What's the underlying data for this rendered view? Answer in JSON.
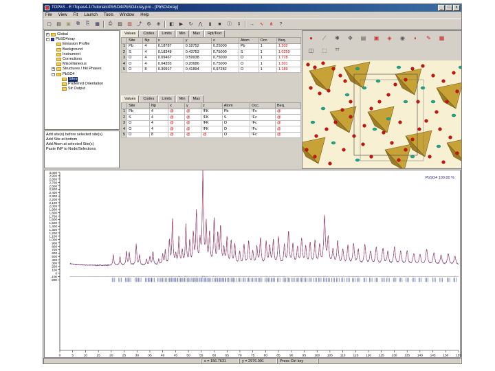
{
  "window": {
    "title": "TOPAS - E:\\Topas4-1\\Tutorials\\PbSO4\\PbSO4xray.pro - [PbSO4xray]",
    "minimize": "_",
    "maximize": "□",
    "close": "x"
  },
  "menu": [
    "File",
    "View",
    "Fit",
    "Launch",
    "Tools",
    "Window",
    "Help"
  ],
  "toolbar_icons": [
    "new-file-icon",
    "open-icon",
    "folder-icon",
    "copy-icon",
    "paste-icon",
    "save-icon",
    "print-icon",
    "fit-icon",
    "chart-icon",
    "launch-icon",
    "settings-icon",
    "zoom-icon",
    "diff-icon",
    "run-icon",
    "sync-icon",
    "peak-icon",
    "bar-icon",
    "stop-icon",
    "info-icon",
    "expand-icon",
    "arrow-icon",
    "wave-icon",
    "peaks-icon",
    "help-icon"
  ],
  "tree": [
    {
      "label": "Global",
      "depth": 0,
      "exp": "+",
      "icon": "folder",
      "sel": false
    },
    {
      "label": "PbSO4xray",
      "depth": 0,
      "exp": "−",
      "icon": "blue",
      "sel": false
    },
    {
      "label": "Emission Profile",
      "depth": 1,
      "exp": "",
      "icon": "folder",
      "sel": false
    },
    {
      "label": "Background",
      "depth": 1,
      "exp": "",
      "icon": "folder",
      "sel": false
    },
    {
      "label": "Instrument",
      "depth": 1,
      "exp": "",
      "icon": "folder",
      "sel": false
    },
    {
      "label": "Corrections",
      "depth": 1,
      "exp": "",
      "icon": "folder",
      "sel": false
    },
    {
      "label": "Miscellaneous",
      "depth": 1,
      "exp": "",
      "icon": "folder",
      "sel": false
    },
    {
      "label": "Structures / hkl Phases",
      "depth": 1,
      "exp": "+",
      "icon": "folder",
      "sel": false
    },
    {
      "label": "PbSO4",
      "depth": 1,
      "exp": "−",
      "icon": "folder",
      "sel": false
    },
    {
      "label": "Sites",
      "depth": 2,
      "exp": "",
      "icon": "folder",
      "sel": true
    },
    {
      "label": "Preferred Orientation",
      "depth": 2,
      "exp": "",
      "icon": "folder",
      "sel": false
    },
    {
      "label": "Str Output",
      "depth": 2,
      "exp": "",
      "icon": "folder",
      "sel": false
    }
  ],
  "context_menu": [
    "Add site(s) before selected site(s)",
    "Add Site at bottom",
    "Add Atom at selected Site(s)",
    "Paste INP to Node/Selections"
  ],
  "table1": {
    "tabs": [
      "Values",
      "Codes",
      "Limits",
      "Min",
      "Max",
      "Rpt/Text"
    ],
    "headers": [
      "",
      "Site",
      "Np",
      "x",
      "y",
      "z",
      "Atom",
      "Occ.",
      "Beq."
    ],
    "rows": [
      [
        "1",
        "Pb",
        "4",
        "0.18787",
        "0.18752",
        "0.25000",
        "Pb",
        "1",
        "1.302"
      ],
      [
        "2",
        "S",
        "4",
        "0.18348",
        "0.43753",
        "0.75000",
        "S",
        "1",
        "1.0259"
      ],
      [
        "3",
        "O",
        "4",
        "0.09467",
        "0.59938",
        "0.75000",
        "O",
        "1",
        "1.778"
      ],
      [
        "4",
        "O",
        "4",
        "0.04355",
        "0.20686",
        "0.75000",
        "O",
        "1",
        "1.301"
      ],
      [
        "5",
        "O",
        "8",
        "0.30917",
        "0.41894",
        "0.97282",
        "O",
        "1",
        "1.189"
      ]
    ]
  },
  "table2": {
    "tabs": [
      "Values",
      "Codes",
      "Limits",
      "Min",
      "Max"
    ],
    "headers": [
      "",
      "Site",
      "Np",
      "x",
      "y",
      "z",
      "Atom",
      "Occ.",
      "Beq."
    ],
    "rows": [
      [
        "1",
        "Pb",
        "4",
        "@",
        "@",
        "!FK",
        "Pb",
        "!Fc",
        "@"
      ],
      [
        "2",
        "S",
        "4",
        "@",
        "@",
        "!FK",
        "S",
        "!Fc",
        "@"
      ],
      [
        "3",
        "O",
        "4",
        "@",
        "@",
        "!FK",
        "O",
        "!Fc",
        "@"
      ],
      [
        "4",
        "O",
        "4",
        "@",
        "@",
        "!FK",
        "O",
        "!Fc",
        "@"
      ],
      [
        "5",
        "O",
        "8",
        "@",
        "@",
        "@",
        "O",
        "!Fc",
        "@"
      ]
    ]
  },
  "structure_icons": [
    "atom-icon",
    "bond-icon",
    "rotate-icon",
    "move-icon",
    "layers-icon",
    "box-icon",
    "view-icon",
    "sphere-icon",
    "color-icon",
    "pencil-icon",
    "grid-icon",
    "camera-icon",
    "select-icon",
    "tt-icon"
  ],
  "status": {
    "x": "x = 156.7631",
    "y": "y = 2976.091",
    "mode": "Press Ctrl key"
  },
  "colors": {
    "observed": "#22228a",
    "calc": "#cc4455",
    "diff": "#888888",
    "ticks": "#1f2a8a",
    "pb": "#c8120a",
    "s": "#1fa58a",
    "polyhedra": "#c7a237",
    "background": "#f7f0d2"
  },
  "chart_data": {
    "type": "line",
    "legend": "PbSO4 100.00 %",
    "xlim": [
      0,
      155
    ],
    "ylim": [
      -2300,
      3000
    ],
    "x_ticks": [
      0,
      5,
      10,
      15,
      20,
      25,
      30,
      35,
      40,
      45,
      50,
      55,
      60,
      65,
      70,
      75,
      80,
      85,
      90,
      95,
      100,
      105,
      110,
      115,
      120,
      125,
      130,
      135,
      140,
      145,
      150,
      155
    ],
    "y_ticks": [
      3000,
      2900,
      2800,
      2700,
      2600,
      2500,
      2400,
      2300,
      2200,
      2100,
      2000,
      1900,
      1800,
      1700,
      1600,
      1500,
      1400,
      1300,
      1200,
      1100,
      1000,
      900,
      800,
      700,
      600,
      500,
      400,
      300,
      200,
      100,
      0,
      -100,
      -200
    ],
    "y_tick_labels": [
      "3,000",
      "2,900",
      "2,800",
      "2,700",
      "2,600",
      "2,500",
      "2,400",
      "2,300",
      "2,200",
      "2,100",
      "2,000",
      "1,900",
      "1,800",
      "1,700",
      "1,600",
      "1,500",
      "1,400",
      "1,300",
      "1,200",
      "1,100",
      "1,000",
      "900",
      "800",
      "700",
      "600",
      "500",
      "400",
      "300",
      "200",
      "100",
      "0",
      "-100",
      "-200"
    ],
    "background_level": 230,
    "peaks": [
      [
        20.8,
        330
      ],
      [
        23.4,
        260
      ],
      [
        25.9,
        420
      ],
      [
        27.0,
        390
      ],
      [
        29.7,
        640
      ],
      [
        31.0,
        300
      ],
      [
        33.7,
        180
      ],
      [
        35.0,
        250
      ],
      [
        36.2,
        400
      ],
      [
        38.5,
        170
      ],
      [
        40.0,
        300
      ],
      [
        41.0,
        420
      ],
      [
        42.6,
        720
      ],
      [
        43.8,
        1350
      ],
      [
        45.1,
        300
      ],
      [
        46.3,
        830
      ],
      [
        47.6,
        400
      ],
      [
        49.0,
        1150
      ],
      [
        50.5,
        700
      ],
      [
        51.9,
        900
      ],
      [
        53.1,
        1560
      ],
      [
        54.5,
        650
      ],
      [
        55.6,
        2760
      ],
      [
        56.9,
        1200
      ],
      [
        58.2,
        900
      ],
      [
        60.0,
        1340
      ],
      [
        61.4,
        860
      ],
      [
        62.5,
        1100
      ],
      [
        63.8,
        450
      ],
      [
        65.0,
        800
      ],
      [
        66.6,
        700
      ],
      [
        68.0,
        600
      ],
      [
        69.9,
        380
      ],
      [
        71.6,
        600
      ],
      [
        73.4,
        700
      ],
      [
        75.0,
        400
      ],
      [
        76.6,
        520
      ],
      [
        78.0,
        780
      ],
      [
        80.2,
        660
      ],
      [
        81.6,
        540
      ],
      [
        83.0,
        700
      ],
      [
        85.0,
        820
      ],
      [
        87.3,
        560
      ],
      [
        88.9,
        980
      ],
      [
        90.6,
        600
      ],
      [
        92.4,
        500
      ],
      [
        94.0,
        760
      ],
      [
        95.6,
        520
      ],
      [
        97.3,
        640
      ],
      [
        99.2,
        700
      ],
      [
        101.0,
        560
      ],
      [
        102.9,
        1430
      ],
      [
        104.3,
        760
      ],
      [
        106.2,
        440
      ],
      [
        108.0,
        680
      ],
      [
        110.0,
        440
      ],
      [
        112.0,
        560
      ],
      [
        114.2,
        600
      ],
      [
        116.0,
        440
      ],
      [
        118.6,
        600
      ],
      [
        120.8,
        400
      ],
      [
        123.0,
        500
      ],
      [
        125.6,
        480
      ],
      [
        127.5,
        380
      ],
      [
        130.1,
        520
      ],
      [
        132.5,
        390
      ],
      [
        135.0,
        420
      ],
      [
        137.6,
        330
      ],
      [
        140.0,
        300
      ],
      [
        142.6,
        460
      ],
      [
        145.4,
        350
      ],
      [
        148.2,
        280
      ],
      [
        151.0,
        330
      ],
      [
        153.6,
        260
      ]
    ],
    "difference_offset": -100,
    "tick_row": -200
  }
}
